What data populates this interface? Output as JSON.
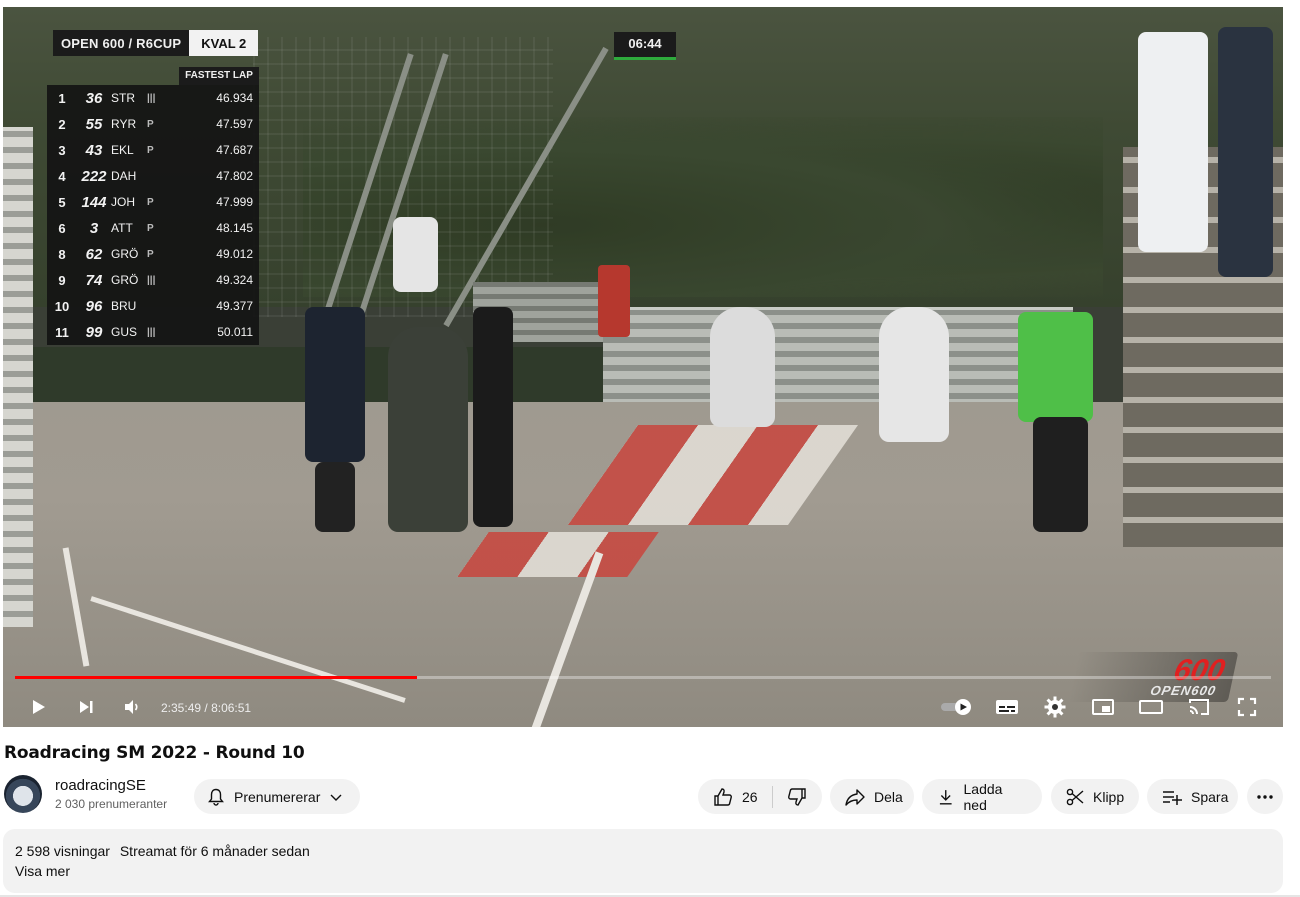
{
  "video": {
    "race_overlay": {
      "class_label": "OPEN 600 / R6CUP",
      "session_label": "KVAL 2",
      "clock": "06:44",
      "fastest_lap_label": "FASTEST LAP",
      "rows": [
        {
          "pos": "1",
          "num": "36",
          "driver": "STR",
          "mark": "|||",
          "lap": "46.934"
        },
        {
          "pos": "2",
          "num": "55",
          "driver": "RYR",
          "mark": "P",
          "lap": "47.597"
        },
        {
          "pos": "3",
          "num": "43",
          "driver": "EKL",
          "mark": "P",
          "lap": "47.687"
        },
        {
          "pos": "4",
          "num": "222",
          "driver": "DAH",
          "mark": "",
          "lap": "47.802"
        },
        {
          "pos": "5",
          "num": "144",
          "driver": "JOH",
          "mark": "P",
          "lap": "47.999"
        },
        {
          "pos": "6",
          "num": "3",
          "driver": "ATT",
          "mark": "P",
          "lap": "48.145"
        },
        {
          "pos": "8",
          "num": "62",
          "driver": "GRÖ",
          "mark": "P",
          "lap": "49.012"
        },
        {
          "pos": "9",
          "num": "74",
          "driver": "GRÖ",
          "mark": "|||",
          "lap": "49.324"
        },
        {
          "pos": "10",
          "num": "96",
          "driver": "BRU",
          "mark": "",
          "lap": "49.377"
        },
        {
          "pos": "11",
          "num": "99",
          "driver": "GUS",
          "mark": "|||",
          "lap": "50.011"
        }
      ]
    },
    "logo_number": "600",
    "logo_text": "OPEN600",
    "progress_fraction": 0.32,
    "current_time": "2:35:49",
    "separator": " / ",
    "total_time": "8:06:51"
  },
  "title": "Roadracing SM 2022 - Round 10",
  "channel": {
    "name": "roadracingSE",
    "subscribers": "2 030 prenumeranter",
    "subscribe_label": "Prenumererar"
  },
  "actions": {
    "likes": "26",
    "share": "Dela",
    "download": "Ladda ned",
    "clip": "Klipp",
    "save": "Spara"
  },
  "description": {
    "views": "2 598 visningar",
    "streamed": "Streamat för 6 månader sedan",
    "more": "Visa mer"
  },
  "colors": {
    "progress": "#ff0000",
    "accent_clock": "#2eaa3c"
  }
}
